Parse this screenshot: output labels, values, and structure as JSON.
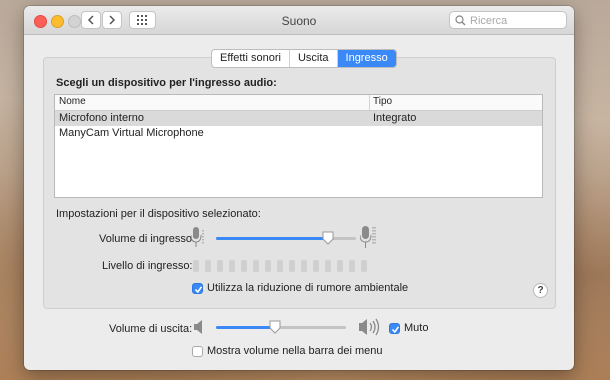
{
  "window": {
    "title": "Suono"
  },
  "search": {
    "placeholder": "Ricerca"
  },
  "tabs": [
    {
      "label": "Effetti sonori",
      "active": false
    },
    {
      "label": "Uscita",
      "active": false
    },
    {
      "label": "Ingresso",
      "active": true
    }
  ],
  "input_section": {
    "title": "Scegli un dispositivo per l'ingresso audio:",
    "columns": [
      "Nome",
      "Tipo"
    ],
    "devices": [
      {
        "name": "Microfono interno",
        "type": "Integrato",
        "selected": true
      },
      {
        "name": "ManyCam Virtual Microphone",
        "type": "",
        "selected": false
      }
    ]
  },
  "device_settings": {
    "title": "Impostazioni per il dispositivo selezionato:",
    "input_volume_label": "Volume di ingresso:",
    "input_volume": 0.8,
    "input_level_label": "Livello di ingresso:",
    "input_level": 0,
    "noise_reduction_label": "Utilizza la riduzione di rumore ambientale",
    "noise_reduction": true
  },
  "output": {
    "volume_label": "Volume di uscita:",
    "volume": 0.45,
    "mute_label": "Muto",
    "mute": true,
    "menubar_label": "Mostra volume nella barra dei menu",
    "menubar": false
  },
  "help": {
    "label": "?"
  },
  "colors": {
    "accent": "#3b89f6",
    "selected_row": "#dadada"
  },
  "icons": [
    "back-icon",
    "forward-icon",
    "grid-icon",
    "search-icon",
    "mic-low-icon",
    "mic-high-icon",
    "speaker-low-icon",
    "speaker-high-icon",
    "checkmark-icon",
    "help-icon"
  ]
}
